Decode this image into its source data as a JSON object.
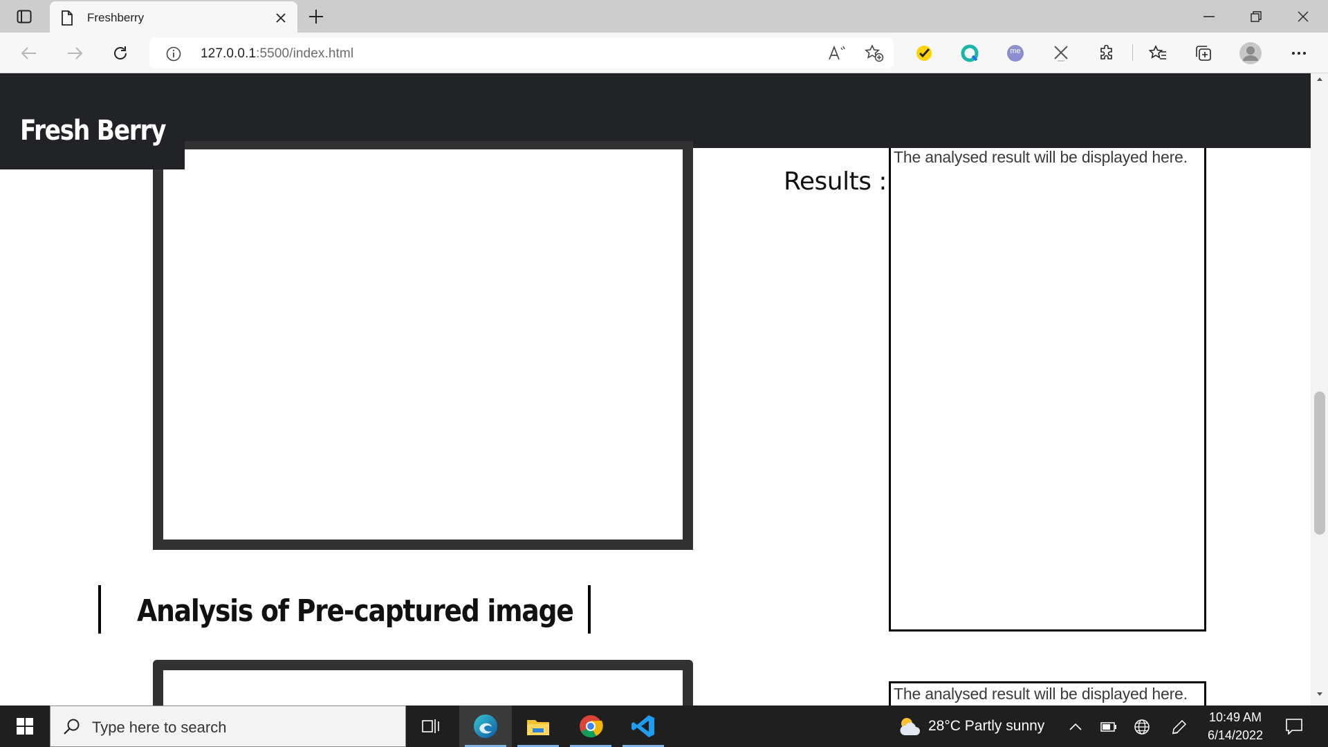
{
  "browser": {
    "tab_title": "Freshberry",
    "url_host": "127.0.0.1",
    "url_rest": ":5500/index.html",
    "icons": {
      "tab_actions": "tab-actions-icon",
      "page": "page-icon",
      "close": "close-icon",
      "new_tab": "plus-icon",
      "minimize": "minimize-icon",
      "restore": "restore-icon",
      "window_close": "window-close-icon",
      "back": "back-arrow-icon",
      "forward": "forward-arrow-icon",
      "refresh": "refresh-icon",
      "info": "info-icon",
      "read_aloud": "read-aloud-icon",
      "add_favorite": "add-favorite-icon",
      "extensions": "puzzle-icon",
      "favorites": "favorites-icon",
      "collections": "collections-icon",
      "profile": "profile-avatar-icon",
      "more": "more-dots-icon"
    },
    "extension_me_label": "me"
  },
  "page": {
    "brand": "Fresh Berry",
    "results_label": "Results :",
    "result_placeholder_1": "The analysed result will be displayed here.",
    "result_placeholder_2": "The analysed result will be displayed here.",
    "section_heading": "Analysis of Pre-captured image"
  },
  "taskbar": {
    "search_placeholder": "Type here to search",
    "weather": "28°C  Partly sunny",
    "time": "10:49 AM",
    "date": "6/14/2022"
  },
  "colors": {
    "header_bg": "#222326",
    "frame_border": "#323232",
    "taskbar_bg": "#1f1f1f",
    "tab_strip_bg": "#cdcdcd"
  }
}
